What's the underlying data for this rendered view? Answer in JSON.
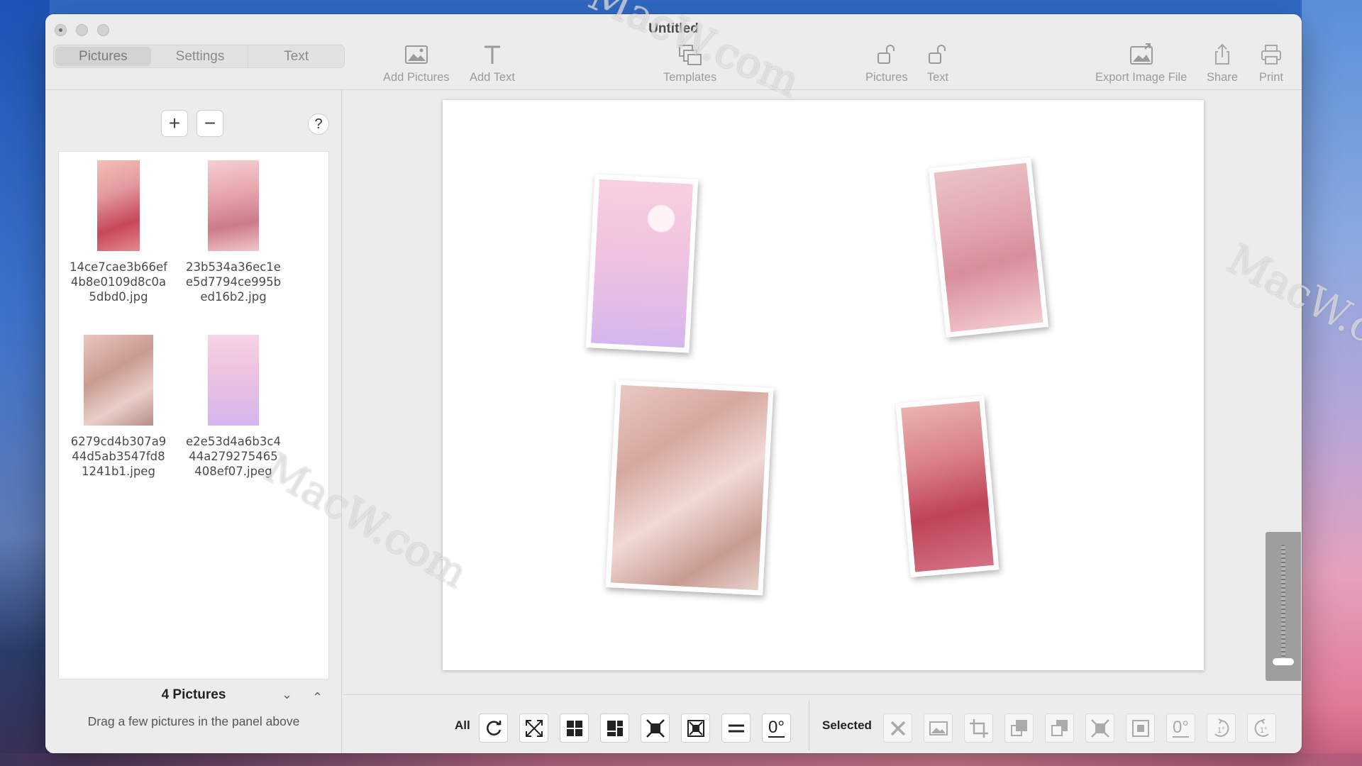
{
  "window": {
    "title": "Untitled"
  },
  "mode_tabs": [
    {
      "label": "Pictures",
      "active": true
    },
    {
      "label": "Settings",
      "active": false
    },
    {
      "label": "Text",
      "active": false
    }
  ],
  "toolbar": {
    "add_pictures": "Add Pictures",
    "add_text": "Add Text",
    "templates": "Templates",
    "pictures_lock": "Pictures",
    "text_lock": "Text",
    "export": "Export Image File",
    "share": "Share",
    "print": "Print"
  },
  "sidebar": {
    "add_symbol": "+",
    "remove_symbol": "−",
    "help_symbol": "?",
    "thumbnails": [
      {
        "name_lines": [
          "14ce7cae3b66ef",
          "4b8e0109d8c0a",
          "5dbd0.jpg"
        ],
        "colors": [
          "#e8a0a0",
          "#c8505a",
          "#f3c2b8"
        ]
      },
      {
        "name_lines": [
          "23b534a36ec1e",
          "e5d7794ce995b",
          "ed16b2.jpg"
        ],
        "colors": [
          "#f0c4c8",
          "#d98f9a",
          "#b87a80"
        ]
      },
      {
        "name_lines": [
          "6279cd4b307a9",
          "44d5ab3547fd8",
          "1241b1.jpeg"
        ],
        "colors": [
          "#e9c3bf",
          "#c79a8e",
          "#f4dcd5"
        ]
      },
      {
        "name_lines": [
          "e2e53d4a6b3c4",
          "44a279275465",
          "408ef07.jpeg"
        ],
        "colors": [
          "#f6d2e4",
          "#e2b7dc",
          "#d2b6ec"
        ]
      }
    ],
    "count_label": "4 Pictures",
    "hint": "Drag a few pictures in the panel above"
  },
  "bottom_bar": {
    "all_label": "All",
    "selected_label": "Selected",
    "all_tools": [
      "rotate-random-icon",
      "fit-scatter-icon",
      "grid-2x2-icon",
      "grid-mosaic-icon",
      "fill-frame-icon",
      "center-frame-icon",
      "equal-size-icon",
      "rotate-zero-icon"
    ],
    "selected_tools": [
      "delete-icon",
      "image-icon",
      "crop-icon",
      "bring-front-icon",
      "send-back-icon",
      "fill-frame-icon",
      "center-frame-icon",
      "rotate-zero-icon",
      "rotate-right-1-icon",
      "rotate-left-1-icon"
    ],
    "zero_deg": "0°",
    "one_deg": "1°"
  },
  "watermarks": [
    "MacW.com",
    "MacW.com",
    "MacW.c"
  ],
  "colors": {
    "window_bg": "#ececec",
    "accent_text": "#9b9b9b"
  }
}
